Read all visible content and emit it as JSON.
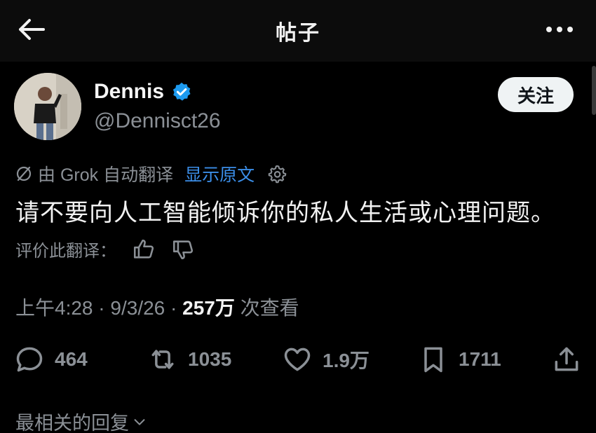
{
  "header": {
    "title": "帖子"
  },
  "author": {
    "name": "Dennis",
    "handle": "@Dennisct26",
    "verified": true,
    "verified_color": "#1d9bf0"
  },
  "follow_button": {
    "label": "关注"
  },
  "translation": {
    "label": "由 Grok 自动翻译",
    "show_original": "显示原文",
    "accent_color": "#3b8ee8"
  },
  "post": {
    "text": "请不要向人工智能倾诉你的私人生活或心理问题。"
  },
  "rating": {
    "label": "评价此翻译："
  },
  "meta": {
    "time": "上午4:28",
    "date": "9/3/26",
    "views_count": "257万",
    "views_label": "次查看"
  },
  "actions": {
    "replies": "464",
    "reposts": "1035",
    "likes": "1.9万",
    "bookmarks": "1711"
  },
  "replies_sort": {
    "label": "最相关的回复"
  },
  "icons": [
    "back-arrow-icon",
    "more-dots-icon",
    "verified-badge-icon",
    "grok-icon",
    "gear-icon",
    "thumbs-up-icon",
    "thumbs-down-icon",
    "reply-icon",
    "repost-icon",
    "like-icon",
    "bookmark-icon",
    "share-icon",
    "chevron-down-icon"
  ]
}
